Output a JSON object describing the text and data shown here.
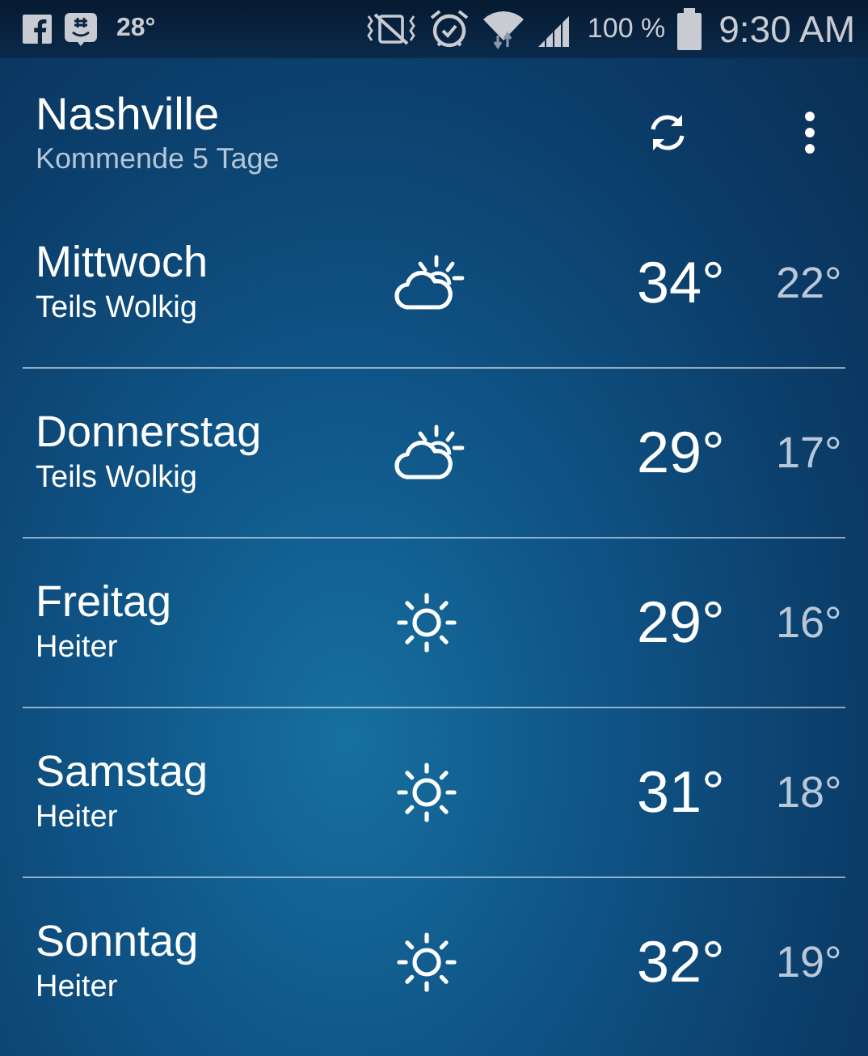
{
  "status_bar": {
    "temperature": "28°",
    "battery": "100 %",
    "time": "9:30 AM"
  },
  "header": {
    "city": "Nashville",
    "subtitle": "Kommende 5 Tage"
  },
  "days": [
    {
      "day": "Mittwoch",
      "condition": "Teils Wolkig",
      "kind": "partly-cloudy",
      "high": "34°",
      "low": "22°"
    },
    {
      "day": "Donnerstag",
      "condition": "Teils Wolkig",
      "kind": "partly-cloudy",
      "high": "29°",
      "low": "17°"
    },
    {
      "day": "Freitag",
      "condition": "Heiter",
      "kind": "sunny",
      "high": "29°",
      "low": "16°"
    },
    {
      "day": "Samstag",
      "condition": "Heiter",
      "kind": "sunny",
      "high": "31°",
      "low": "18°"
    },
    {
      "day": "Sonntag",
      "condition": "Heiter",
      "kind": "sunny",
      "high": "32°",
      "low": "19°"
    }
  ]
}
